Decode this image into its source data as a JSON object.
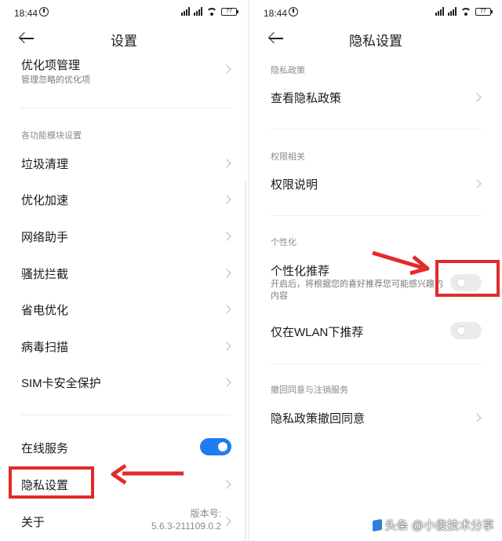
{
  "left": {
    "status": {
      "time": "18:44",
      "battery": "77"
    },
    "title": "设置",
    "top_item": {
      "label": "优化项管理",
      "sub": "管理忽略的优化项"
    },
    "section_label": "各功能模块设置",
    "items": [
      {
        "label": "垃圾清理"
      },
      {
        "label": "优化加速"
      },
      {
        "label": "网络助手"
      },
      {
        "label": "骚扰拦截"
      },
      {
        "label": "省电优化"
      },
      {
        "label": "病毒扫描"
      },
      {
        "label": "SIM卡安全保护"
      }
    ],
    "online_service": {
      "label": "在线服务",
      "on": true
    },
    "privacy": {
      "label": "隐私设置"
    },
    "about": {
      "label": "关于",
      "version_label": "版本号:",
      "version": "5.6.3-211109.0.2"
    }
  },
  "right": {
    "status": {
      "time": "18:44",
      "battery": "77"
    },
    "title": "隐私设置",
    "sec1": {
      "label": "隐私政策",
      "item": "查看隐私政策"
    },
    "sec2": {
      "label": "权限相关",
      "item": "权限说明"
    },
    "sec3": {
      "label": "个性化",
      "personalized": {
        "label": "个性化推荐",
        "sub1": "开启后，将根据您的喜好推荐您可能感兴趣的",
        "sub2": "内容",
        "on": false
      },
      "wlan_only": {
        "label": "仅在WLAN下推荐",
        "on": false
      }
    },
    "sec4": {
      "label": "撤回同意与注销服务",
      "item": "隐私政策撤回同意"
    }
  },
  "watermark": "头条 @小俊技术分享",
  "colors": {
    "accent": "#1f7cf3",
    "highlight": "#e32a2a"
  }
}
